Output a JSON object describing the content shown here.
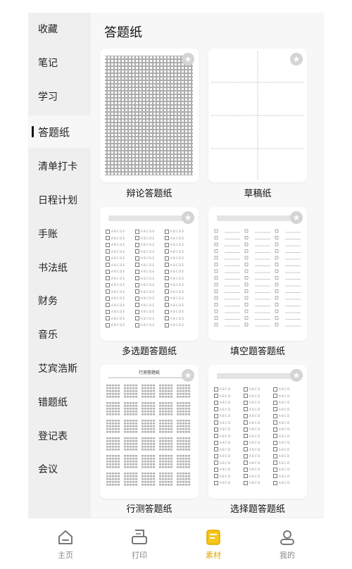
{
  "sidebar": {
    "items": [
      {
        "label": "收藏"
      },
      {
        "label": "笔记"
      },
      {
        "label": "学习"
      },
      {
        "label": "答题纸",
        "active": true
      },
      {
        "label": "清单打卡"
      },
      {
        "label": "日程计划"
      },
      {
        "label": "手账"
      },
      {
        "label": "书法纸"
      },
      {
        "label": "财务"
      },
      {
        "label": "音乐"
      },
      {
        "label": "艾宾浩斯"
      },
      {
        "label": "错题纸"
      },
      {
        "label": "登记表"
      },
      {
        "label": "会议"
      }
    ]
  },
  "main": {
    "title": "答题纸",
    "cards": [
      {
        "label": "辩论答题纸",
        "icon": "star-icon"
      },
      {
        "label": "草稿纸",
        "icon": "star-icon"
      },
      {
        "label": "多选题答题纸",
        "icon": "star-icon",
        "option_text": "A B C D E"
      },
      {
        "label": "填空题答题纸",
        "icon": "star-icon"
      },
      {
        "label": "行测答题纸",
        "icon": "star-icon",
        "sheet_title": "行测答题纸"
      },
      {
        "label": "选择题答题纸",
        "icon": "star-icon",
        "option_text": "A B C D"
      }
    ]
  },
  "tabbar": {
    "tabs": [
      {
        "label": "主页",
        "icon": "home-icon"
      },
      {
        "label": "打印",
        "icon": "printer-icon"
      },
      {
        "label": "素材",
        "icon": "material-icon",
        "active": true
      },
      {
        "label": "我的",
        "icon": "profile-icon"
      }
    ]
  },
  "colors": {
    "accent": "#e0a800",
    "sidebar_bg": "#efefef",
    "main_bg": "#f7f7f7"
  }
}
